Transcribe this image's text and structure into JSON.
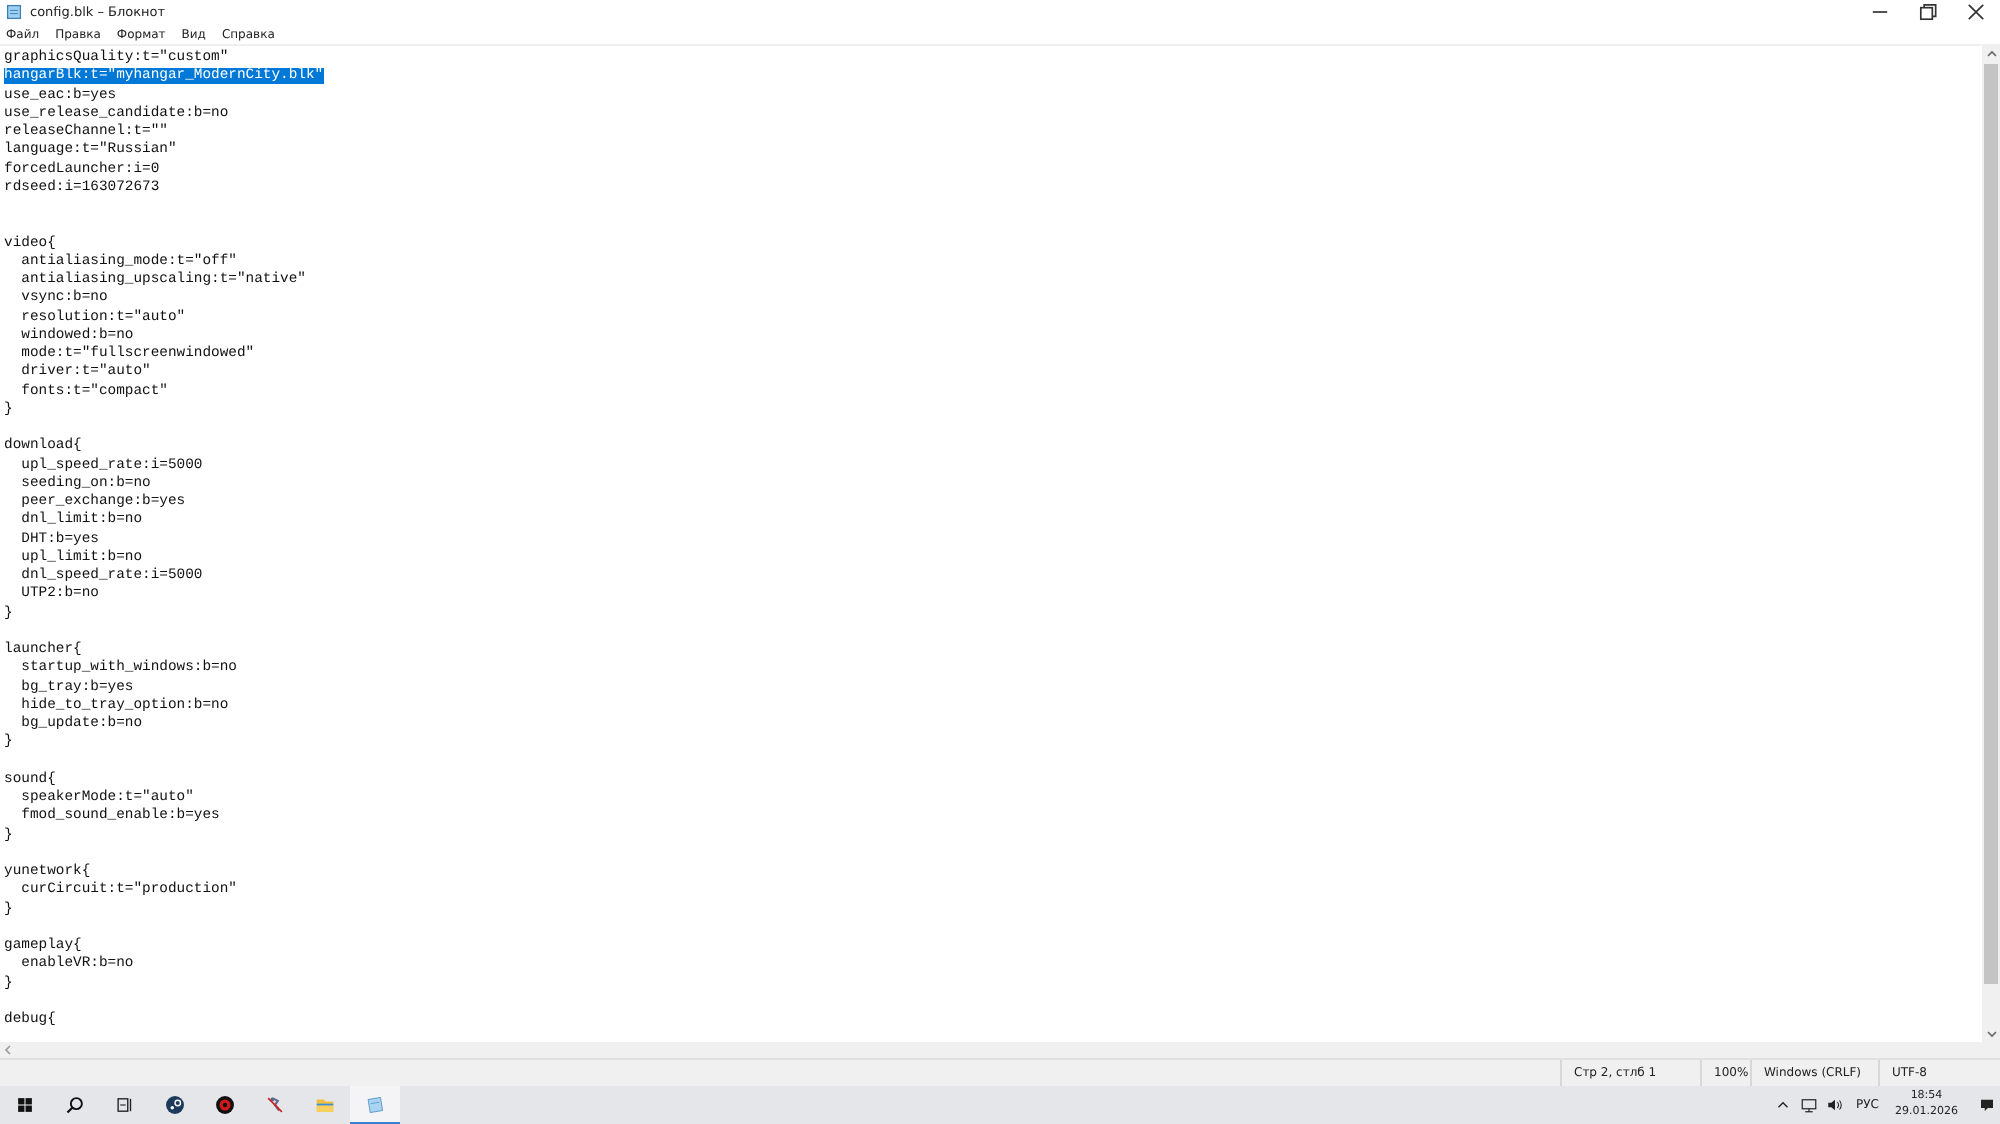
{
  "window": {
    "title": "config.blk – Блокнот"
  },
  "menu": [
    {
      "label": "Файл"
    },
    {
      "label": "Правка"
    },
    {
      "label": "Формат"
    },
    {
      "label": "Вид"
    },
    {
      "label": "Справка"
    }
  ],
  "editor": {
    "lines": [
      {
        "kind": "code",
        "text": "graphicsQuality:t=\"custom\"",
        "selected": false
      },
      {
        "kind": "code",
        "text": "hangarBlk:t=\"myhangar_ModernCity.blk\"",
        "selected": true
      },
      {
        "kind": "code",
        "text": "use_eac:b=yes",
        "selected": false
      },
      {
        "kind": "code",
        "text": "use_release_candidate:b=no",
        "selected": false
      },
      {
        "kind": "code",
        "text": "releaseChannel:t=\"\"",
        "selected": false
      },
      {
        "kind": "code",
        "text": "language:t=\"Russian\"",
        "selected": false
      },
      {
        "kind": "code",
        "text": "forcedLauncher:i=0",
        "selected": false
      },
      {
        "kind": "code",
        "text": "rdseed:i=163072673",
        "selected": false
      },
      {
        "kind": "blank"
      },
      {
        "kind": "blank"
      },
      {
        "kind": "code",
        "text": "video{",
        "selected": false
      },
      {
        "kind": "code",
        "text": "  antialiasing_mode:t=\"off\"",
        "selected": false
      },
      {
        "kind": "code",
        "text": "  antialiasing_upscaling:t=\"native\"",
        "selected": false
      },
      {
        "kind": "code",
        "text": "  vsync:b=no",
        "selected": false
      },
      {
        "kind": "code",
        "text": "  resolution:t=\"auto\"",
        "selected": false
      },
      {
        "kind": "code",
        "text": "  windowed:b=no",
        "selected": false
      },
      {
        "kind": "code",
        "text": "  mode:t=\"fullscreenwindowed\"",
        "selected": false
      },
      {
        "kind": "code",
        "text": "  driver:t=\"auto\"",
        "selected": false
      },
      {
        "kind": "code",
        "text": "  fonts:t=\"compact\"",
        "selected": false
      },
      {
        "kind": "code",
        "text": "}",
        "selected": false
      },
      {
        "kind": "blank"
      },
      {
        "kind": "code",
        "text": "download{",
        "selected": false
      },
      {
        "kind": "code",
        "text": "  upl_speed_rate:i=5000",
        "selected": false
      },
      {
        "kind": "code",
        "text": "  seeding_on:b=no",
        "selected": false
      },
      {
        "kind": "code",
        "text": "  peer_exchange:b=yes",
        "selected": false
      },
      {
        "kind": "code",
        "text": "  dnl_limit:b=no",
        "selected": false
      },
      {
        "kind": "code",
        "text": "  DHT:b=yes",
        "selected": false
      },
      {
        "kind": "code",
        "text": "  upl_limit:b=no",
        "selected": false
      },
      {
        "kind": "code",
        "text": "  dnl_speed_rate:i=5000",
        "selected": false
      },
      {
        "kind": "code",
        "text": "  UTP2:b=no",
        "selected": false
      },
      {
        "kind": "code",
        "text": "}",
        "selected": false
      },
      {
        "kind": "blank"
      },
      {
        "kind": "code",
        "text": "launcher{",
        "selected": false
      },
      {
        "kind": "code",
        "text": "  startup_with_windows:b=no",
        "selected": false
      },
      {
        "kind": "code",
        "text": "  bg_tray:b=yes",
        "selected": false
      },
      {
        "kind": "code",
        "text": "  hide_to_tray_option:b=no",
        "selected": false
      },
      {
        "kind": "code",
        "text": "  bg_update:b=no",
        "selected": false
      },
      {
        "kind": "code",
        "text": "}",
        "selected": false
      },
      {
        "kind": "blank"
      },
      {
        "kind": "code",
        "text": "sound{",
        "selected": false
      },
      {
        "kind": "code",
        "text": "  speakerMode:t=\"auto\"",
        "selected": false
      },
      {
        "kind": "code",
        "text": "  fmod_sound_enable:b=yes",
        "selected": false
      },
      {
        "kind": "code",
        "text": "}",
        "selected": false
      },
      {
        "kind": "blank"
      },
      {
        "kind": "code",
        "text": "yunetwork{",
        "selected": false
      },
      {
        "kind": "code",
        "text": "  curCircuit:t=\"production\"",
        "selected": false
      },
      {
        "kind": "code",
        "text": "}",
        "selected": false
      },
      {
        "kind": "blank"
      },
      {
        "kind": "code",
        "text": "gameplay{",
        "selected": false
      },
      {
        "kind": "code",
        "text": "  enableVR:b=no",
        "selected": false
      },
      {
        "kind": "code",
        "text": "}",
        "selected": false
      },
      {
        "kind": "blank"
      },
      {
        "kind": "code",
        "text": "debug{",
        "selected": false
      }
    ]
  },
  "status_bar": {
    "position": "Стр 2, стлб 1",
    "zoom": "100%",
    "line_ending": "Windows (CRLF)",
    "encoding": "UTF-8"
  },
  "taskbar": {
    "apps": [
      {
        "kind": "start"
      },
      {
        "kind": "search"
      },
      {
        "kind": "taskview"
      },
      {
        "kind": "circle"
      },
      {
        "kind": "redgear"
      },
      {
        "kind": "figure"
      },
      {
        "kind": "folder"
      },
      {
        "kind": "notepad",
        "selected": true
      }
    ],
    "language": "РУС",
    "time": "18:54",
    "date": "29.01.2026"
  }
}
